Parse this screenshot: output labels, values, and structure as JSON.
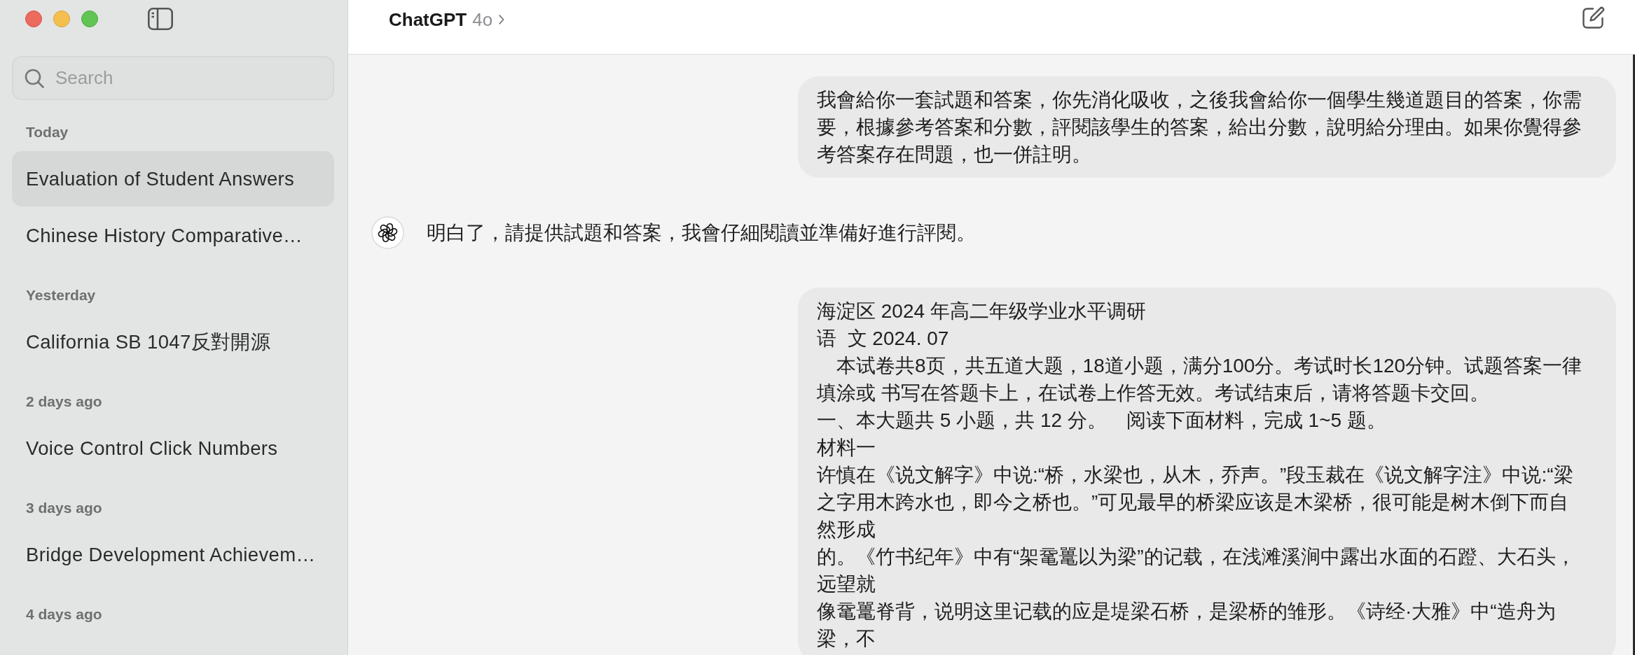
{
  "sidebar": {
    "search": {
      "placeholder": "Search"
    },
    "sections": [
      {
        "label": "Today",
        "items": [
          {
            "title": "Evaluation of Student Answers",
            "selected": true
          },
          {
            "title": "Chinese History Comparative…",
            "selected": false
          }
        ]
      },
      {
        "label": "Yesterday",
        "items": [
          {
            "title": "California SB 1047反對開源",
            "selected": false
          }
        ]
      },
      {
        "label": "2 days ago",
        "items": [
          {
            "title": "Voice Control Click Numbers",
            "selected": false
          }
        ]
      },
      {
        "label": "3 days ago",
        "items": [
          {
            "title": "Bridge Development Achievem…",
            "selected": false
          }
        ]
      },
      {
        "label": "4 days ago"
      }
    ]
  },
  "header": {
    "title": "ChatGPT",
    "model": "4o"
  },
  "messages": [
    {
      "kind": "user",
      "paragraphs": [
        [
          "我會給你一套試題和答案，你先消化吸收，之後我會給你一個學生幾道題目的答案，你需",
          "要，根據參考答案和分數，評閱該學生的答案，給出分數，說明給分理由。如果你覺得參",
          "考答案存在問題，也一併註明。"
        ]
      ]
    },
    {
      "kind": "assistant",
      "paragraphs": [
        [
          "明白了，請提供試題和答案，我會仔細閱讀並準備好進行評閱。"
        ]
      ]
    },
    {
      "kind": "user",
      "paragraphs": [
        [
          "海淀区 2024 年高二年级学业水平调研"
        ],
        [
          "语  文 2024. 07"
        ],
        [
          "　本试卷共8页，共五道大题，18道小题，满分100分。考试时长120分钟。试题答案一律",
          "填涂或 书写在答题卡上，在试卷上作答无效。考试结束后，请将答题卡交回。"
        ],
        [
          "一、本大题共 5 小题，共 12 分。　阅读下面材料，完成 1~5 题。"
        ],
        [
          "材料一"
        ],
        [
          "许慎在《说文解字》中说:“桥，水梁也，从木，乔声。”段玉裁在《说文解字注》中说:“梁",
          "之字用木跨水也，即今之桥也。”可见最早的桥梁应该是木梁桥，很可能是树木倒下而自",
          "然形成"
        ],
        [
          "的。《竹书纪年》中有“架鼋鼍以为梁”的记载，在浅滩溪涧中露出水面的石蹬、大石头，",
          "远望就"
        ],
        [
          "像鼋鼍脊背，说明这里记载的应是堤梁石桥，是梁桥的雏形。《诗经·大雅》中“造舟为",
          "梁，不"
        ]
      ]
    }
  ]
}
